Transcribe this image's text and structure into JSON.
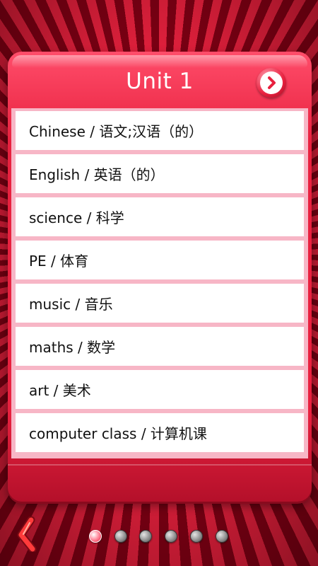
{
  "header": {
    "title": "Unit 1",
    "next_icon": "chevron-right-icon"
  },
  "vocab": [
    "Chinese / 语文;汉语（的）",
    "English / 英语（的）",
    "science / 科学",
    "PE / 体育",
    "music / 音乐",
    "maths / 数学",
    "art / 美术",
    "computer class / 计算机课"
  ],
  "pager": {
    "page_count": 6,
    "active_index": 0
  },
  "colors": {
    "accent_red": "#e8213f",
    "panel_pink": "#f7b6c6",
    "active_dot": "#ff7d92"
  },
  "nav": {
    "back_icon": "back-arrow-icon"
  }
}
